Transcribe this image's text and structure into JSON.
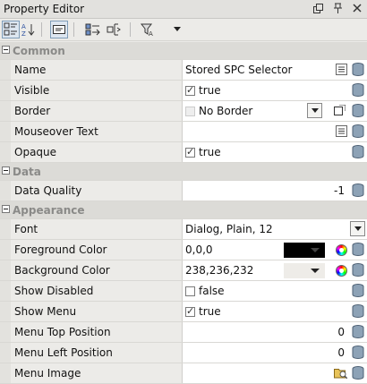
{
  "window": {
    "title": "Property Editor"
  },
  "sections": {
    "common": {
      "label": "Common",
      "name": {
        "label": "Name",
        "value": "Stored SPC Selector"
      },
      "visible": {
        "label": "Visible",
        "value": "true"
      },
      "border": {
        "label": "Border",
        "value": "No Border"
      },
      "mouseover": {
        "label": "Mouseover Text",
        "value": ""
      },
      "opaque": {
        "label": "Opaque",
        "value": "true"
      }
    },
    "data": {
      "label": "Data",
      "quality": {
        "label": "Data Quality",
        "value": "-1"
      }
    },
    "appearance": {
      "label": "Appearance",
      "font": {
        "label": "Font",
        "value": "Dialog, Plain, 12"
      },
      "fg": {
        "label": "Foreground Color",
        "value": "0,0,0",
        "color": "#000000"
      },
      "bg": {
        "label": "Background Color",
        "value": "238,236,232",
        "color": "#EEECE8"
      },
      "disabled": {
        "label": "Show Disabled",
        "value": "false"
      },
      "menu": {
        "label": "Show Menu",
        "value": "true"
      },
      "menu_top": {
        "label": "Menu Top Position",
        "value": "0"
      },
      "menu_left": {
        "label": "Menu Left Position",
        "value": "0"
      },
      "menu_image": {
        "label": "Menu Image",
        "value": ""
      }
    }
  },
  "colors": {
    "panel_bg": "#ECEBE8",
    "category_bg": "#DCDBD7",
    "value_bg": "#FFFFFF",
    "category_text": "#8A8A88"
  }
}
